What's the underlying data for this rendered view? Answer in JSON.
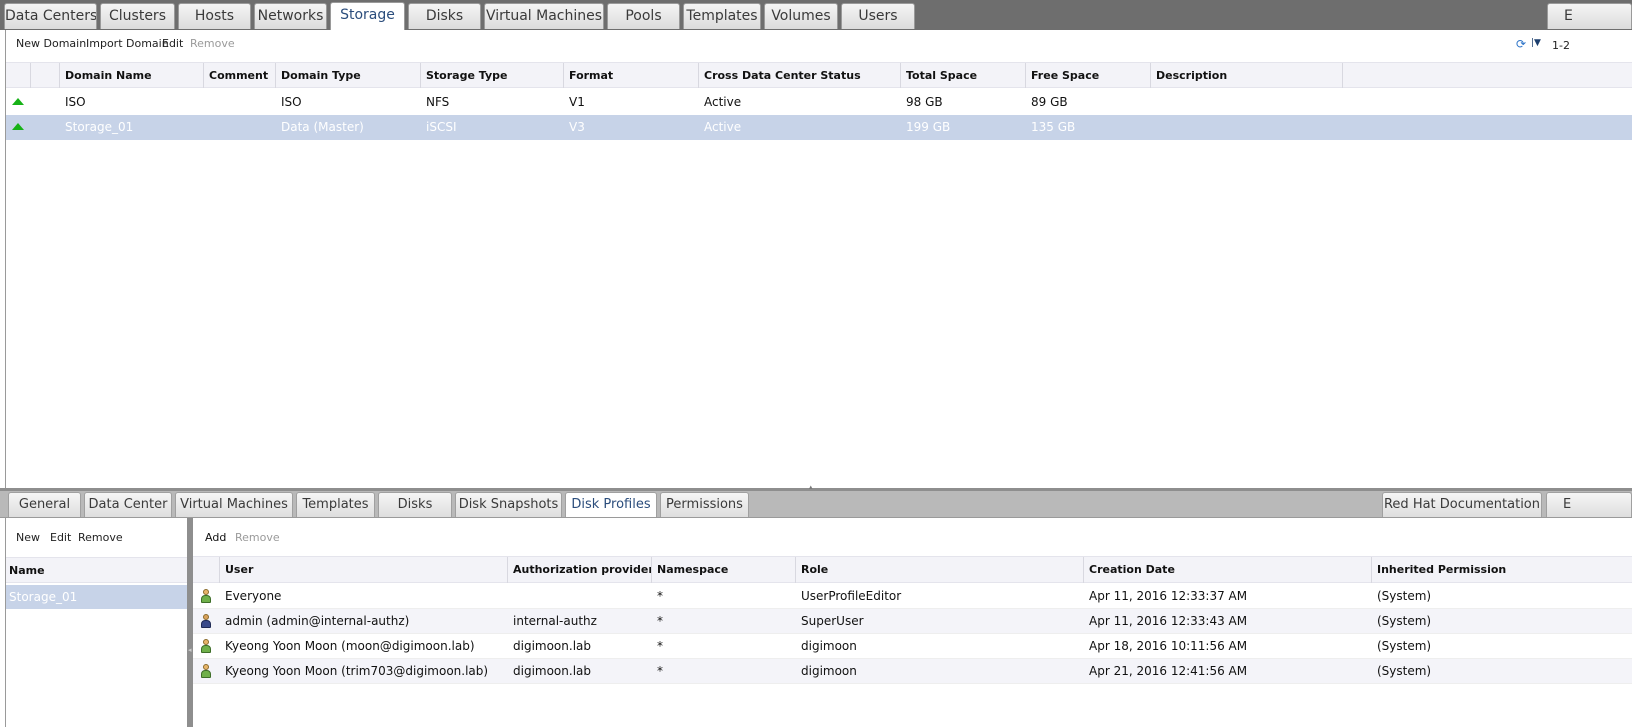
{
  "main_tabs": [
    {
      "label": "Data Centers",
      "active": false
    },
    {
      "label": "Clusters",
      "active": false
    },
    {
      "label": "Hosts",
      "active": false
    },
    {
      "label": "Networks",
      "active": false
    },
    {
      "label": "Storage",
      "active": true
    },
    {
      "label": "Disks",
      "active": false
    },
    {
      "label": "Virtual Machines",
      "active": false
    },
    {
      "label": "Pools",
      "active": false
    },
    {
      "label": "Templates",
      "active": false
    },
    {
      "label": "Volumes",
      "active": false
    },
    {
      "label": "Users",
      "active": false
    },
    {
      "label": "E",
      "active": false
    }
  ],
  "toolbar": {
    "new_domain": "New Domain",
    "import_domain": "Import Domain",
    "edit": "Edit",
    "remove": "Remove",
    "pager": "1-2"
  },
  "storage_table": {
    "columns": [
      "Domain Name",
      "Comment",
      "Domain Type",
      "Storage Type",
      "Format",
      "Cross Data Center Status",
      "Total Space",
      "Free Space",
      "Description"
    ],
    "rows": [
      {
        "name": "ISO",
        "comment": "",
        "domain_type": "ISO",
        "storage_type": "NFS",
        "format": "V1",
        "status": "Active",
        "total": "98 GB",
        "free": "89 GB",
        "description": "",
        "selected": false
      },
      {
        "name": "Storage_01",
        "comment": "",
        "domain_type": "Data (Master)",
        "storage_type": "iSCSI",
        "format": "V3",
        "status": "Active",
        "total": "199 GB",
        "free": "135 GB",
        "description": "",
        "selected": true
      }
    ]
  },
  "sub_tabs": [
    {
      "label": "General",
      "active": false
    },
    {
      "label": "Data Center",
      "active": false
    },
    {
      "label": "Virtual Machines",
      "active": false
    },
    {
      "label": "Templates",
      "active": false
    },
    {
      "label": "Disks",
      "active": false
    },
    {
      "label": "Disk Snapshots",
      "active": false
    },
    {
      "label": "Disk Profiles",
      "active": true
    },
    {
      "label": "Permissions",
      "active": false
    }
  ],
  "docs_button": "Red Hat Documentation",
  "docs_extra": "E",
  "profiles": {
    "new": "New",
    "edit": "Edit",
    "remove": "Remove",
    "header": "Name",
    "rows": [
      "Storage_01"
    ]
  },
  "permissions": {
    "add": "Add",
    "remove": "Remove",
    "columns": [
      "User",
      "Authorization provider",
      "Namespace",
      "Role",
      "Creation Date",
      "Inherited Permission"
    ],
    "rows": [
      {
        "icon": "user-icon",
        "user": "Everyone",
        "provider": "",
        "namespace": "*",
        "role": "UserProfileEditor",
        "date": "Apr 11, 2016 12:33:37 AM",
        "inherited": "(System)"
      },
      {
        "icon": "admin-user-icon",
        "user": "admin (admin@internal-authz)",
        "provider": "internal-authz",
        "namespace": "*",
        "role": "SuperUser",
        "date": "Apr 11, 2016 12:33:43 AM",
        "inherited": "(System)"
      },
      {
        "icon": "user-icon",
        "user": "Kyeong Yoon Moon (moon@digimoon.lab)",
        "provider": "digimoon.lab",
        "namespace": "*",
        "role": "digimoon",
        "date": "Apr 18, 2016 10:11:56 AM",
        "inherited": "(System)"
      },
      {
        "icon": "user-icon",
        "user": "Kyeong Yoon Moon (trim703@digimoon.lab)",
        "provider": "digimoon.lab",
        "namespace": "*",
        "role": "digimoon",
        "date": "Apr 21, 2016 12:41:56 AM",
        "inherited": "(System)"
      }
    ]
  },
  "colors": {
    "selected_row": "#c7d3e8",
    "active_tab_text": "#2b4d7c",
    "status_up": "#17b217",
    "disabled_text": "#9a9a9a"
  }
}
